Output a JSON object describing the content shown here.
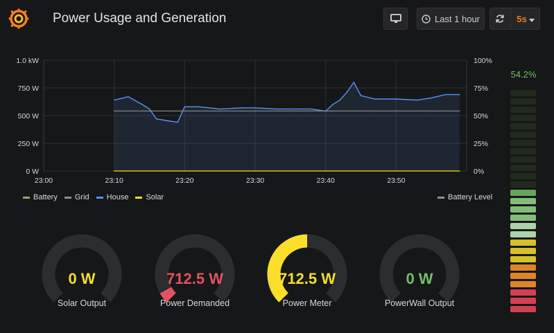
{
  "header": {
    "title": "Power Usage and Generation",
    "time_range": "Last 1 hour",
    "refresh_interval": "5s"
  },
  "chart_data": {
    "type": "line",
    "x_ticks": [
      "23:00",
      "23:10",
      "23:20",
      "23:30",
      "23:40",
      "23:50"
    ],
    "y_left_ticks": [
      "0 W",
      "250 W",
      "500 W",
      "750 W",
      "1.0 kW"
    ],
    "y_right_ticks": [
      "0%",
      "25%",
      "50%",
      "75%",
      "100%"
    ],
    "ylim_left": [
      0,
      1000
    ],
    "ylim_right": [
      0,
      100
    ],
    "grid": true,
    "x": [
      "23:10",
      "23:12",
      "23:14",
      "23:15",
      "23:16",
      "23:18",
      "23:19",
      "23:20",
      "23:22",
      "23:25",
      "23:28",
      "23:30",
      "23:33",
      "23:35",
      "23:38",
      "23:40",
      "23:41",
      "23:42",
      "23:43",
      "23:44",
      "23:45",
      "23:47",
      "23:50",
      "23:53",
      "23:55",
      "23:57",
      "23:59"
    ],
    "series": [
      {
        "name": "Battery",
        "axis": "left",
        "values": []
      },
      {
        "name": "Grid",
        "axis": "left",
        "values": []
      },
      {
        "name": "House",
        "axis": "left",
        "values": [
          640,
          670,
          600,
          560,
          470,
          450,
          440,
          580,
          580,
          560,
          570,
          570,
          560,
          560,
          560,
          540,
          600,
          640,
          710,
          800,
          680,
          650,
          650,
          640,
          660,
          690,
          690
        ]
      },
      {
        "name": "Solar",
        "axis": "left",
        "values": [
          0,
          0,
          0,
          0,
          0,
          0,
          0,
          0,
          0,
          0,
          0,
          0,
          0,
          0,
          0,
          0,
          0,
          0,
          0,
          0,
          0,
          0,
          0,
          0,
          0,
          0,
          0
        ]
      },
      {
        "name": "Battery Level",
        "axis": "right",
        "values": [
          54.2,
          54.2,
          54.2,
          54.2,
          54.2,
          54.2,
          54.2,
          54.2,
          54.2,
          54.2,
          54.2,
          54.2,
          54.2,
          54.2,
          54.2,
          54.2,
          54.2,
          54.2,
          54.2,
          54.2,
          54.2,
          54.2,
          54.2,
          54.2,
          54.2,
          54.2,
          54.2
        ]
      }
    ],
    "colors": {
      "Battery": "#7eb26d",
      "Grid": "#8f8f8f",
      "House": "#5794f2",
      "Solar": "#fade2a",
      "Battery Level": "#8f8f8f"
    }
  },
  "legend": {
    "left": [
      {
        "label": "Battery",
        "color": "#7eb26d"
      },
      {
        "label": "Grid",
        "color": "#8f8f8f"
      },
      {
        "label": "House",
        "color": "#5794f2"
      },
      {
        "label": "Solar",
        "color": "#fade2a"
      }
    ],
    "right": {
      "label": "Battery Level",
      "color": "#8f8f8f"
    }
  },
  "gauges": [
    {
      "value": "0 W",
      "label": "Solar Output",
      "fraction": 0.0,
      "color": "#fade2a"
    },
    {
      "value": "712.5 W",
      "label": "Power Demanded",
      "fraction": 0.06,
      "color": "#e0535f"
    },
    {
      "value": "712.5 W",
      "label": "Power Meter",
      "fraction": 0.5,
      "color": "#fade2a"
    },
    {
      "value": "0 W",
      "label": "PowerWall Output",
      "fraction": 0.0,
      "color": "#73bf69"
    }
  ],
  "battery": {
    "value": "54.2%",
    "level_percent": 54.2,
    "segment_colors": [
      "#73bf69",
      "#73bf69",
      "#73bf69",
      "#73bf69",
      "#73bf69",
      "#73bf69",
      "#73bf69",
      "#73bf69",
      "#73bf69",
      "#73bf69",
      "#73bf69",
      "#73bf69",
      "#73bf69",
      "#96d98d",
      "#96d98d",
      "#96d98d",
      "#c8f2c2",
      "#c8f2c2",
      "#fade2a",
      "#fade2a",
      "#fade2a",
      "#ff9830",
      "#ff9830",
      "#ff9830",
      "#f2495c",
      "#f2495c",
      "#f2495c"
    ]
  }
}
